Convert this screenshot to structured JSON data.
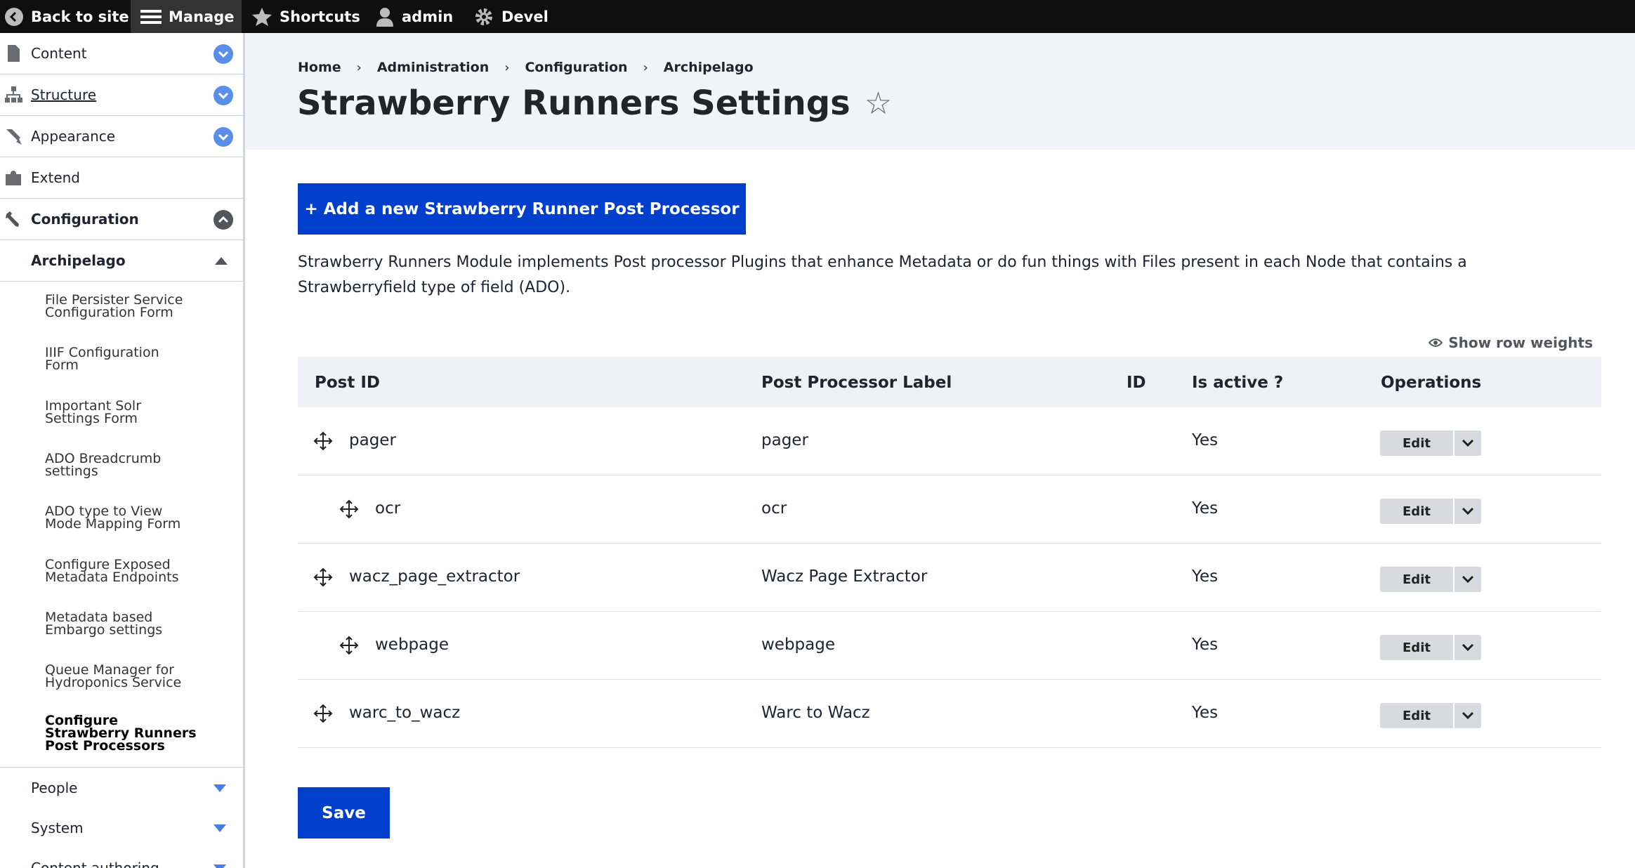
{
  "toolbar": {
    "back_label": "Back to site",
    "manage_label": "Manage",
    "shortcuts_label": "Shortcuts",
    "user_label": "admin",
    "devel_label": "Devel"
  },
  "sidebar": {
    "items": [
      {
        "label": "Content",
        "icon": "document-icon"
      },
      {
        "label": "Structure",
        "icon": "structure-icon"
      },
      {
        "label": "Appearance",
        "icon": "brush-icon"
      },
      {
        "label": "Extend",
        "icon": "puzzle-icon"
      },
      {
        "label": "Configuration",
        "icon": "wrench-icon"
      }
    ],
    "subheader": "Archipelago",
    "subitems": [
      {
        "line1": "File Persister Service",
        "line2": "Configuration Form"
      },
      {
        "line1": "IIIF Configuration",
        "line2": "Form"
      },
      {
        "line1": "Important Solr",
        "line2": "Settings Form"
      },
      {
        "line1": "ADO Breadcrumb",
        "line2": "settings"
      },
      {
        "line1": "ADO type to View",
        "line2": "Mode Mapping Form"
      },
      {
        "line1": "Configure Exposed",
        "line2": "Metadata Endpoints"
      },
      {
        "line1": "Metadata based",
        "line2": "Embargo settings"
      },
      {
        "line1": "Queue Manager for",
        "line2": "Hydroponics Service"
      }
    ],
    "active_sub": {
      "line1": "Configure",
      "line2": "Strawberry Runners",
      "line3": "Post Processors"
    },
    "bottom": [
      {
        "label": "People"
      },
      {
        "label": "System"
      },
      {
        "label": "Content authoring"
      }
    ]
  },
  "breadcrumb": [
    "Home",
    "Administration",
    "Configuration",
    "Archipelago"
  ],
  "page": {
    "title": "Strawberry Runners Settings",
    "add_button": "+ Add a new Strawberry Runner Post Processor",
    "description": "Strawberry Runners Module implements Post processor Plugins that enhance Metadata or do fun things with Files present in each Node that contains a Strawberryfield type of field (ADO).",
    "show_weights": "Show row weights",
    "save_button": "Save"
  },
  "table": {
    "headers": [
      "Post ID",
      "Post Processor Label",
      "ID",
      "Is active ?",
      "Operations"
    ],
    "rows": [
      {
        "post_id": "pager",
        "label": "pager",
        "id": "",
        "active": "Yes",
        "edit": "Edit"
      },
      {
        "post_id": "ocr",
        "label": "ocr",
        "id": "",
        "active": "Yes",
        "edit": "Edit"
      },
      {
        "post_id": "wacz_page_extractor",
        "label": "Wacz Page Extractor",
        "id": "",
        "active": "Yes",
        "edit": "Edit"
      },
      {
        "post_id": "webpage",
        "label": "webpage",
        "id": "",
        "active": "Yes",
        "edit": "Edit"
      },
      {
        "post_id": "warc_to_wacz",
        "label": "Warc to Wacz",
        "id": "",
        "active": "Yes",
        "edit": "Edit"
      }
    ]
  },
  "colors": {
    "primary": "#003ecc",
    "toolbar_bg": "#0f0f0f",
    "header_bg": "#f3f4f9",
    "toggle_blue": "#5a8ee8"
  }
}
